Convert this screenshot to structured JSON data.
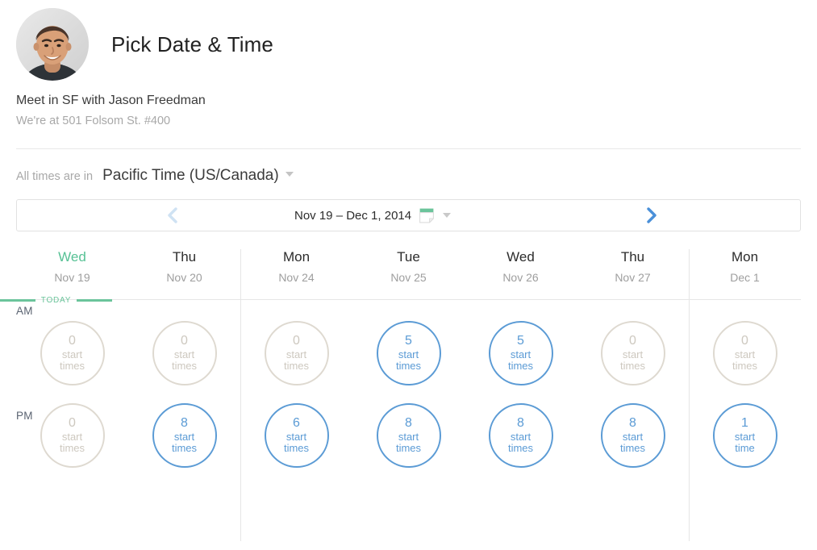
{
  "header": {
    "title": "Pick Date & Time",
    "avatar_name": "avatar"
  },
  "meeting": {
    "title": "Meet in SF with Jason Freedman",
    "location": "We're at 501 Folsom St. #400"
  },
  "timezone": {
    "prefix": "All times are in",
    "value": "Pacific Time (US/Canada)"
  },
  "date_nav": {
    "range": "Nov 19 – Dec 1, 2014",
    "prev_icon": "chevron-left-icon",
    "next_icon": "chevron-right-icon",
    "calendar_icon": "calendar-icon"
  },
  "calendar": {
    "today_label": "TODAY",
    "periods": [
      "AM",
      "PM"
    ],
    "days": [
      {
        "name": "Wed",
        "date": "Nov 19",
        "today": true,
        "am": {
          "count": "0",
          "label": "start\ntimes",
          "active": false
        },
        "pm": {
          "count": "0",
          "label": "start\ntimes",
          "active": false
        }
      },
      {
        "name": "Thu",
        "date": "Nov 20",
        "today": false,
        "am": {
          "count": "0",
          "label": "start\ntimes",
          "active": false
        },
        "pm": {
          "count": "8",
          "label": "start\ntimes",
          "active": true
        }
      },
      {
        "name": "Mon",
        "date": "Nov 24",
        "today": false,
        "am": {
          "count": "0",
          "label": "start\ntimes",
          "active": false
        },
        "pm": {
          "count": "6",
          "label": "start\ntimes",
          "active": true
        }
      },
      {
        "name": "Tue",
        "date": "Nov 25",
        "today": false,
        "am": {
          "count": "5",
          "label": "start\ntimes",
          "active": true
        },
        "pm": {
          "count": "8",
          "label": "start\ntimes",
          "active": true
        }
      },
      {
        "name": "Wed",
        "date": "Nov 26",
        "today": false,
        "am": {
          "count": "5",
          "label": "start\ntimes",
          "active": true
        },
        "pm": {
          "count": "8",
          "label": "start\ntimes",
          "active": true
        }
      },
      {
        "name": "Thu",
        "date": "Nov 27",
        "today": false,
        "am": {
          "count": "0",
          "label": "start\ntimes",
          "active": false
        },
        "pm": {
          "count": "8",
          "label": "start\ntimes",
          "active": true
        }
      },
      {
        "name": "Mon",
        "date": "Dec 1",
        "today": false,
        "am": {
          "count": "0",
          "label": "start\ntimes",
          "active": false
        },
        "pm": {
          "count": "1",
          "label": "start\ntime",
          "active": true
        }
      }
    ]
  },
  "colors": {
    "accent_green": "#6bc49b",
    "accent_blue": "#5b9bd5",
    "next_arrow_blue": "#4a90d9",
    "prev_arrow_blue": "#cfe2f3",
    "inactive_border": "#ded9d0",
    "inactive_text": "#cdc8bf"
  }
}
